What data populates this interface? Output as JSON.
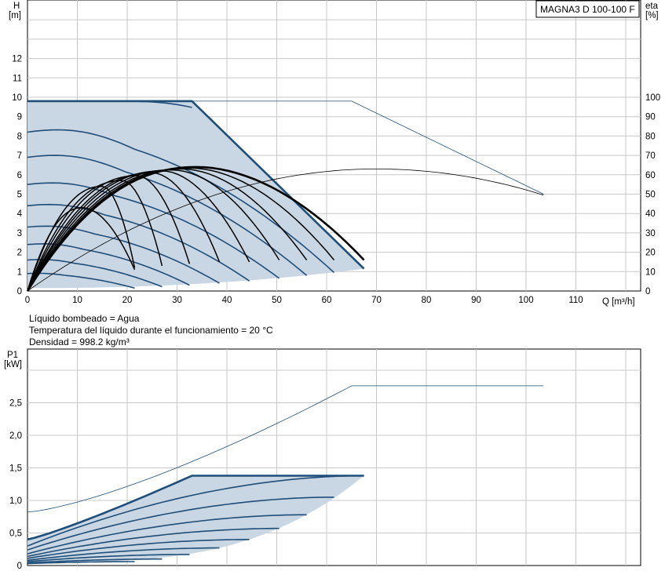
{
  "model_label": "MAGNA3 D 100-100 F",
  "notes": [
    "Líquido bombeado = Agua",
    "Temperatura del líquido durante el funcionamiento = 20 °C",
    "Densidad = 998.2 kg/m³"
  ],
  "colors": {
    "curve_blue": "#1f4e79",
    "envelope_fill": "#c9d6e3",
    "grid": "#c8c8c8",
    "efficiency_black": "#000000"
  },
  "chart_data": [
    {
      "type": "line",
      "name": "head-efficiency",
      "xlabel": "Q [m³/h]",
      "ylabel": [
        "H",
        "[m]"
      ],
      "y2label": [
        "eta",
        "[%]"
      ],
      "xlim": [
        0,
        120
      ],
      "ylim": [
        0,
        15
      ],
      "y2lim": [
        0,
        150
      ],
      "x_ticks": [
        0,
        10,
        20,
        30,
        40,
        50,
        60,
        70,
        80,
        90,
        100,
        110
      ],
      "y_ticks": [
        0,
        1,
        2,
        3,
        4,
        5,
        6,
        7,
        8,
        9,
        10,
        11,
        12
      ],
      "y2_ticks": [
        0,
        10,
        20,
        30,
        40,
        50,
        60,
        70,
        80,
        90,
        100
      ],
      "grid": true,
      "envelope": [
        [
          0,
          9.8
        ],
        [
          33,
          9.8
        ],
        [
          67.5,
          1.15
        ],
        [
          20,
          0.15
        ],
        [
          0,
          0
        ]
      ],
      "max_curve": [
        [
          0,
          9.8
        ],
        [
          65,
          9.8
        ],
        [
          85,
          7.6
        ],
        [
          103.5,
          5.0
        ]
      ],
      "max_efficiency_curve": [
        [
          0,
          0
        ],
        [
          10,
          1.9
        ],
        [
          20,
          3.4
        ],
        [
          30,
          4.5
        ],
        [
          40,
          5.3
        ],
        [
          50,
          5.85
        ],
        [
          60,
          6.2
        ],
        [
          70,
          6.3
        ],
        [
          80,
          6.2
        ],
        [
          90,
          5.9
        ],
        [
          100,
          5.3
        ],
        [
          103.5,
          5.1
        ]
      ],
      "speed_curves": [
        {
          "h0": 9.8,
          "q0": 17,
          "qend": 67.5,
          "hend": 1.15
        },
        {
          "h0": 8.2,
          "q0": 0,
          "qend": 61.5,
          "hend": 0.95
        },
        {
          "h0": 6.9,
          "q0": 0,
          "qend": 56,
          "hend": 0.8
        },
        {
          "h0": 5.5,
          "q0": 0,
          "qend": 50.5,
          "hend": 0.65
        },
        {
          "h0": 4.4,
          "q0": 0,
          "qend": 44.5,
          "hend": 0.52
        },
        {
          "h0": 3.3,
          "q0": 0,
          "qend": 38.5,
          "hend": 0.4
        },
        {
          "h0": 2.4,
          "q0": 0,
          "qend": 32.5,
          "hend": 0.3
        },
        {
          "h0": 1.6,
          "q0": 0,
          "qend": 27,
          "hend": 0.22
        },
        {
          "h0": 0.9,
          "q0": 0,
          "qend": 21.5,
          "hend": 0.15
        }
      ],
      "efficiency_curves": [
        {
          "qpk": 34,
          "pk": 64,
          "qend": 67.5,
          "end": 16
        },
        {
          "qpk": 32.5,
          "pk": 63.5,
          "qend": 61.5,
          "end": 16
        },
        {
          "qpk": 31,
          "pk": 63,
          "qend": 56,
          "end": 16
        },
        {
          "qpk": 29,
          "pk": 62.5,
          "qend": 50.5,
          "end": 16
        },
        {
          "qpk": 27,
          "pk": 62,
          "qend": 44.5,
          "end": 15
        },
        {
          "qpk": 25,
          "pk": 61,
          "qend": 38.5,
          "end": 15
        },
        {
          "qpk": 22,
          "pk": 59.5,
          "qend": 32.5,
          "end": 14
        },
        {
          "qpk": 19,
          "pk": 57,
          "qend": 27,
          "end": 13
        },
        {
          "qpk": 15,
          "pk": 54,
          "qend": 21.5,
          "end": 12
        },
        {
          "qpk": 11,
          "pk": 43,
          "qend": 21.5,
          "end": 11
        }
      ]
    },
    {
      "type": "line",
      "name": "power",
      "ylabel": [
        "P1",
        "[kW]"
      ],
      "xlim": [
        0,
        120
      ],
      "ylim": [
        0,
        3.3
      ],
      "y_ticks": [
        0,
        0.5,
        1.0,
        1.5,
        2.0,
        2.5
      ],
      "y_tick_labels": [
        "0",
        "0,5",
        "1,0",
        "1,5",
        "2,0",
        "2,5"
      ],
      "grid": true,
      "envelope": [
        [
          0,
          0.4
        ],
        [
          33,
          1.38
        ],
        [
          67.5,
          1.38
        ],
        [
          20,
          0.05
        ],
        [
          0,
          0
        ]
      ],
      "max_curve": [
        [
          0,
          0.82
        ],
        [
          20,
          1.3
        ],
        [
          40,
          1.85
        ],
        [
          60,
          2.5
        ],
        [
          65,
          2.76
        ],
        [
          103.5,
          2.76
        ]
      ],
      "speed_curves": [
        {
          "p0": 0.4,
          "pkink": 1.38,
          "qkink": 33,
          "qend": 67.5,
          "pend": 1.38
        },
        {
          "p0": 0.3,
          "qend": 67.5,
          "pend": 1.38
        },
        {
          "p0": 0.24,
          "qend": 61.5,
          "pend": 1.05
        },
        {
          "p0": 0.18,
          "qend": 56,
          "pend": 0.78
        },
        {
          "p0": 0.14,
          "qend": 50.5,
          "pend": 0.57
        },
        {
          "p0": 0.11,
          "qend": 44.5,
          "pend": 0.4
        },
        {
          "p0": 0.08,
          "qend": 38.5,
          "pend": 0.27
        },
        {
          "p0": 0.06,
          "qend": 32.5,
          "pend": 0.17
        },
        {
          "p0": 0.04,
          "qend": 27,
          "pend": 0.1
        },
        {
          "p0": 0.03,
          "qend": 21.5,
          "pend": 0.06
        }
      ]
    }
  ]
}
